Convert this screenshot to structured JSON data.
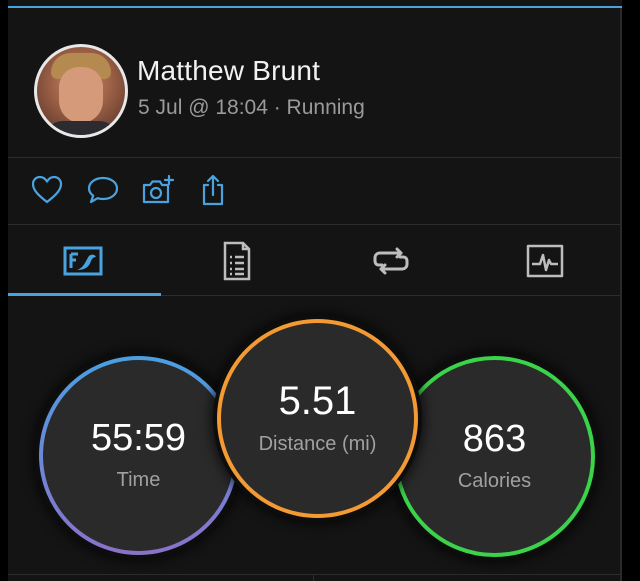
{
  "header": {
    "user_name": "Matthew Brunt",
    "activity_meta": "5 Jul @ 18:04 · Running"
  },
  "actions": [
    {
      "icon": "heart-icon"
    },
    {
      "icon": "comment-icon"
    },
    {
      "icon": "add-photo-icon"
    },
    {
      "icon": "share-icon"
    }
  ],
  "tabs": [
    {
      "icon": "summary-icon",
      "selected": true
    },
    {
      "icon": "details-icon",
      "selected": false
    },
    {
      "icon": "laps-icon",
      "selected": false
    },
    {
      "icon": "charts-icon",
      "selected": false
    }
  ],
  "stats": {
    "time": {
      "value": "55:59",
      "label": "Time",
      "ring_color": "#4a9fe0"
    },
    "distance": {
      "value": "5.51",
      "label": "Distance (mi)",
      "ring_color": "#f39a33"
    },
    "calories": {
      "value": "863",
      "label": "Calories",
      "ring_color": "#3ad34a"
    }
  },
  "colors": {
    "accent": "#4aa3df",
    "background": "#141414"
  }
}
